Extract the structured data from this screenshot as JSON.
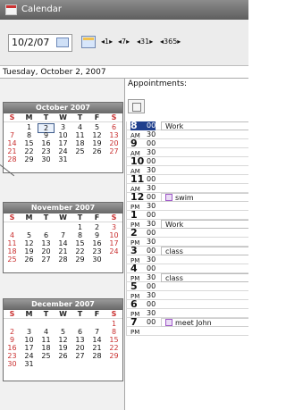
{
  "window": {
    "title": "Calendar"
  },
  "toolbar": {
    "date": "10/2/07",
    "nav": [
      "1",
      "7",
      "31",
      "365"
    ]
  },
  "date_strip": "Tuesday, October 2, 2007",
  "mini_calendars": [
    {
      "title": "October 2007",
      "days": [
        "S",
        "M",
        "T",
        "W",
        "T",
        "F",
        "S"
      ],
      "weeks": [
        [
          "",
          "1",
          "2",
          "3",
          "4",
          "5",
          "6"
        ],
        [
          "7",
          "8",
          "9",
          "10",
          "11",
          "12",
          "13"
        ],
        [
          "14",
          "15",
          "16",
          "17",
          "18",
          "19",
          "20"
        ],
        [
          "21",
          "22",
          "23",
          "24",
          "25",
          "26",
          "27"
        ],
        [
          "28",
          "29",
          "30",
          "31",
          "",
          "",
          ""
        ]
      ]
    },
    {
      "title": "November 2007",
      "days": [
        "S",
        "M",
        "T",
        "W",
        "T",
        "F",
        "S"
      ],
      "weeks": [
        [
          "",
          "",
          "",
          "",
          "1",
          "2",
          "3"
        ],
        [
          "4",
          "5",
          "6",
          "7",
          "8",
          "9",
          "10"
        ],
        [
          "11",
          "12",
          "13",
          "14",
          "15",
          "16",
          "17"
        ],
        [
          "18",
          "19",
          "20",
          "21",
          "22",
          "23",
          "24"
        ],
        [
          "25",
          "26",
          "27",
          "28",
          "29",
          "30",
          ""
        ]
      ]
    },
    {
      "title": "December 2007",
      "days": [
        "S",
        "M",
        "T",
        "W",
        "T",
        "F",
        "S"
      ],
      "weeks": [
        [
          "",
          "",
          "",
          "",
          "",
          "",
          "1"
        ],
        [
          "2",
          "3",
          "4",
          "5",
          "6",
          "7",
          "8"
        ],
        [
          "9",
          "10",
          "11",
          "12",
          "13",
          "14",
          "15"
        ],
        [
          "16",
          "17",
          "18",
          "19",
          "20",
          "21",
          "22"
        ],
        [
          "23",
          "24",
          "25",
          "26",
          "27",
          "28",
          "29"
        ],
        [
          "30",
          "31",
          "",
          "",
          "",
          "",
          ""
        ]
      ]
    }
  ],
  "appointments": {
    "title": "Appointments:",
    "times": [
      {
        "hour": "8",
        "ampm": "AM",
        "m1": "00",
        "m2": "30",
        "selected": true
      },
      {
        "hour": "9",
        "ampm": "AM",
        "m1": "00",
        "m2": "30"
      },
      {
        "hour": "10",
        "ampm": "AM",
        "m1": "00",
        "m2": "30"
      },
      {
        "hour": "11",
        "ampm": "AM",
        "m1": "00",
        "m2": "30"
      },
      {
        "hour": "12",
        "ampm": "PM",
        "m1": "00",
        "m2": "30"
      },
      {
        "hour": "1",
        "ampm": "PM",
        "m1": "00",
        "m2": "30"
      },
      {
        "hour": "2",
        "ampm": "PM",
        "m1": "00",
        "m2": "30"
      },
      {
        "hour": "3",
        "ampm": "PM",
        "m1": "00",
        "m2": "30"
      },
      {
        "hour": "4",
        "ampm": "PM",
        "m1": "00",
        "m2": "30"
      },
      {
        "hour": "5",
        "ampm": "PM",
        "m1": "00",
        "m2": "30"
      },
      {
        "hour": "6",
        "ampm": "PM",
        "m1": "00",
        "m2": "30"
      },
      {
        "hour": "7",
        "ampm": "PM",
        "m1": "00",
        "m2": ""
      }
    ],
    "items": [
      {
        "time_index": 0,
        "half": 0,
        "label": "Work",
        "icon": false
      },
      {
        "time_index": 4,
        "half": 0,
        "label": "swim",
        "icon": true
      },
      {
        "time_index": 5,
        "half": 1,
        "label": "Work",
        "icon": false
      },
      {
        "time_index": 7,
        "half": 0,
        "label": "class",
        "icon": false
      },
      {
        "time_index": 8,
        "half": 1,
        "label": "class",
        "icon": false
      },
      {
        "time_index": 11,
        "half": 0,
        "label": "meet John",
        "icon": true
      }
    ]
  }
}
